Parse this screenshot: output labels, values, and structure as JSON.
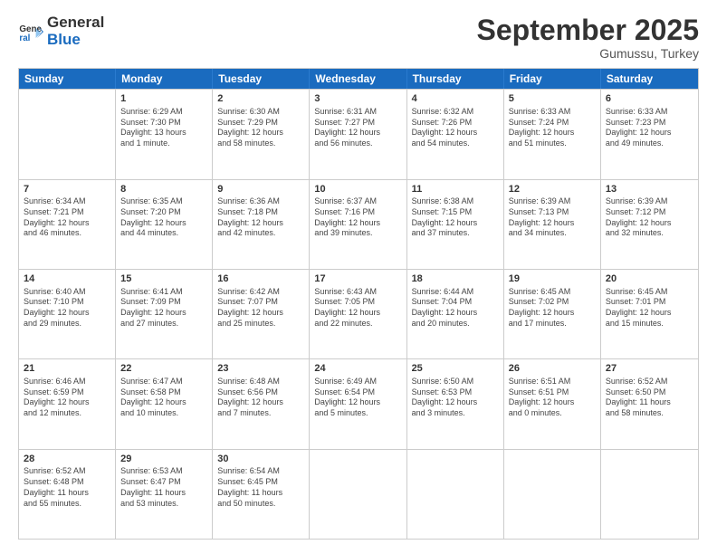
{
  "header": {
    "logo_line1": "General",
    "logo_line2": "Blue",
    "month": "September 2025",
    "location": "Gumussu, Turkey"
  },
  "days_of_week": [
    "Sunday",
    "Monday",
    "Tuesday",
    "Wednesday",
    "Thursday",
    "Friday",
    "Saturday"
  ],
  "weeks": [
    [
      {
        "day": "",
        "lines": []
      },
      {
        "day": "1",
        "lines": [
          "Sunrise: 6:29 AM",
          "Sunset: 7:30 PM",
          "Daylight: 13 hours",
          "and 1 minute."
        ]
      },
      {
        "day": "2",
        "lines": [
          "Sunrise: 6:30 AM",
          "Sunset: 7:29 PM",
          "Daylight: 12 hours",
          "and 58 minutes."
        ]
      },
      {
        "day": "3",
        "lines": [
          "Sunrise: 6:31 AM",
          "Sunset: 7:27 PM",
          "Daylight: 12 hours",
          "and 56 minutes."
        ]
      },
      {
        "day": "4",
        "lines": [
          "Sunrise: 6:32 AM",
          "Sunset: 7:26 PM",
          "Daylight: 12 hours",
          "and 54 minutes."
        ]
      },
      {
        "day": "5",
        "lines": [
          "Sunrise: 6:33 AM",
          "Sunset: 7:24 PM",
          "Daylight: 12 hours",
          "and 51 minutes."
        ]
      },
      {
        "day": "6",
        "lines": [
          "Sunrise: 6:33 AM",
          "Sunset: 7:23 PM",
          "Daylight: 12 hours",
          "and 49 minutes."
        ]
      }
    ],
    [
      {
        "day": "7",
        "lines": [
          "Sunrise: 6:34 AM",
          "Sunset: 7:21 PM",
          "Daylight: 12 hours",
          "and 46 minutes."
        ]
      },
      {
        "day": "8",
        "lines": [
          "Sunrise: 6:35 AM",
          "Sunset: 7:20 PM",
          "Daylight: 12 hours",
          "and 44 minutes."
        ]
      },
      {
        "day": "9",
        "lines": [
          "Sunrise: 6:36 AM",
          "Sunset: 7:18 PM",
          "Daylight: 12 hours",
          "and 42 minutes."
        ]
      },
      {
        "day": "10",
        "lines": [
          "Sunrise: 6:37 AM",
          "Sunset: 7:16 PM",
          "Daylight: 12 hours",
          "and 39 minutes."
        ]
      },
      {
        "day": "11",
        "lines": [
          "Sunrise: 6:38 AM",
          "Sunset: 7:15 PM",
          "Daylight: 12 hours",
          "and 37 minutes."
        ]
      },
      {
        "day": "12",
        "lines": [
          "Sunrise: 6:39 AM",
          "Sunset: 7:13 PM",
          "Daylight: 12 hours",
          "and 34 minutes."
        ]
      },
      {
        "day": "13",
        "lines": [
          "Sunrise: 6:39 AM",
          "Sunset: 7:12 PM",
          "Daylight: 12 hours",
          "and 32 minutes."
        ]
      }
    ],
    [
      {
        "day": "14",
        "lines": [
          "Sunrise: 6:40 AM",
          "Sunset: 7:10 PM",
          "Daylight: 12 hours",
          "and 29 minutes."
        ]
      },
      {
        "day": "15",
        "lines": [
          "Sunrise: 6:41 AM",
          "Sunset: 7:09 PM",
          "Daylight: 12 hours",
          "and 27 minutes."
        ]
      },
      {
        "day": "16",
        "lines": [
          "Sunrise: 6:42 AM",
          "Sunset: 7:07 PM",
          "Daylight: 12 hours",
          "and 25 minutes."
        ]
      },
      {
        "day": "17",
        "lines": [
          "Sunrise: 6:43 AM",
          "Sunset: 7:05 PM",
          "Daylight: 12 hours",
          "and 22 minutes."
        ]
      },
      {
        "day": "18",
        "lines": [
          "Sunrise: 6:44 AM",
          "Sunset: 7:04 PM",
          "Daylight: 12 hours",
          "and 20 minutes."
        ]
      },
      {
        "day": "19",
        "lines": [
          "Sunrise: 6:45 AM",
          "Sunset: 7:02 PM",
          "Daylight: 12 hours",
          "and 17 minutes."
        ]
      },
      {
        "day": "20",
        "lines": [
          "Sunrise: 6:45 AM",
          "Sunset: 7:01 PM",
          "Daylight: 12 hours",
          "and 15 minutes."
        ]
      }
    ],
    [
      {
        "day": "21",
        "lines": [
          "Sunrise: 6:46 AM",
          "Sunset: 6:59 PM",
          "Daylight: 12 hours",
          "and 12 minutes."
        ]
      },
      {
        "day": "22",
        "lines": [
          "Sunrise: 6:47 AM",
          "Sunset: 6:58 PM",
          "Daylight: 12 hours",
          "and 10 minutes."
        ]
      },
      {
        "day": "23",
        "lines": [
          "Sunrise: 6:48 AM",
          "Sunset: 6:56 PM",
          "Daylight: 12 hours",
          "and 7 minutes."
        ]
      },
      {
        "day": "24",
        "lines": [
          "Sunrise: 6:49 AM",
          "Sunset: 6:54 PM",
          "Daylight: 12 hours",
          "and 5 minutes."
        ]
      },
      {
        "day": "25",
        "lines": [
          "Sunrise: 6:50 AM",
          "Sunset: 6:53 PM",
          "Daylight: 12 hours",
          "and 3 minutes."
        ]
      },
      {
        "day": "26",
        "lines": [
          "Sunrise: 6:51 AM",
          "Sunset: 6:51 PM",
          "Daylight: 12 hours",
          "and 0 minutes."
        ]
      },
      {
        "day": "27",
        "lines": [
          "Sunrise: 6:52 AM",
          "Sunset: 6:50 PM",
          "Daylight: 11 hours",
          "and 58 minutes."
        ]
      }
    ],
    [
      {
        "day": "28",
        "lines": [
          "Sunrise: 6:52 AM",
          "Sunset: 6:48 PM",
          "Daylight: 11 hours",
          "and 55 minutes."
        ]
      },
      {
        "day": "29",
        "lines": [
          "Sunrise: 6:53 AM",
          "Sunset: 6:47 PM",
          "Daylight: 11 hours",
          "and 53 minutes."
        ]
      },
      {
        "day": "30",
        "lines": [
          "Sunrise: 6:54 AM",
          "Sunset: 6:45 PM",
          "Daylight: 11 hours",
          "and 50 minutes."
        ]
      },
      {
        "day": "",
        "lines": []
      },
      {
        "day": "",
        "lines": []
      },
      {
        "day": "",
        "lines": []
      },
      {
        "day": "",
        "lines": []
      }
    ]
  ]
}
